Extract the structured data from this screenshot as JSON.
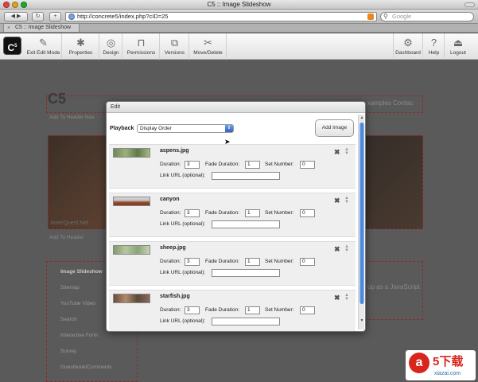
{
  "window": {
    "title": "C5 :: Image Slideshow"
  },
  "browser": {
    "url": "http://concrete5/index.php?cID=25",
    "search_placeholder": "Google",
    "tab_title": "C5 :: Image Slideshow"
  },
  "c5toolbar": {
    "buttons": [
      {
        "label": "Exit Edit Mode",
        "icon": "exit-edit-icon"
      },
      {
        "label": "Properties",
        "icon": "properties-icon"
      },
      {
        "label": "Design",
        "icon": "design-icon"
      },
      {
        "label": "Permissions",
        "icon": "lock-icon"
      },
      {
        "label": "Versions",
        "icon": "versions-icon"
      },
      {
        "label": "Move/Delete",
        "icon": "scissors-icon"
      }
    ],
    "right_buttons": [
      {
        "label": "Dashboard",
        "icon": "gear-icon"
      },
      {
        "label": "Help",
        "icon": "help-icon"
      },
      {
        "label": "Logout",
        "icon": "logout-icon"
      }
    ]
  },
  "page": {
    "brand": "C5",
    "nav_text": "xamples   Contac",
    "add_to_header_nav": "Add To Header Nav",
    "hero_caption": "innerQuest Net",
    "add_to_header": "Add To Header",
    "sidebar_items": [
      "Image Slideshow",
      "Sitemap",
      "YouTube Video",
      "Search",
      "Interactive Form",
      "Survey",
      "Guestbook/Comments"
    ],
    "right_text": "up as a JavaScript"
  },
  "dialog": {
    "title": "Edit",
    "playback_label": "Playback",
    "playback_value": "Display Order",
    "add_image_label": "Add Image",
    "field_labels": {
      "duration": "Duration:",
      "fade_duration": "Fade Duration:",
      "set_number": "Set Number:",
      "link_url": "Link URL (optional):"
    },
    "images": [
      {
        "name": "aspens.jpg",
        "duration": "3",
        "fade_duration": "1",
        "set_number": "0",
        "link_url": ""
      },
      {
        "name": "canyon",
        "duration": "3",
        "fade_duration": "1",
        "set_number": "0",
        "link_url": ""
      },
      {
        "name": "sheep.jpg",
        "duration": "3",
        "fade_duration": "1",
        "set_number": "0",
        "link_url": ""
      },
      {
        "name": "starfish.jpg",
        "duration": "3",
        "fade_duration": "1",
        "set_number": "0",
        "link_url": ""
      }
    ]
  },
  "watermark": {
    "glyph": "a",
    "big": "5下载",
    "small": "xiazai.com"
  },
  "colors": {
    "overlay": "#5a5a5a",
    "accent_blue": "#3e7cd8",
    "edit_outline": "#8b2b2b"
  }
}
